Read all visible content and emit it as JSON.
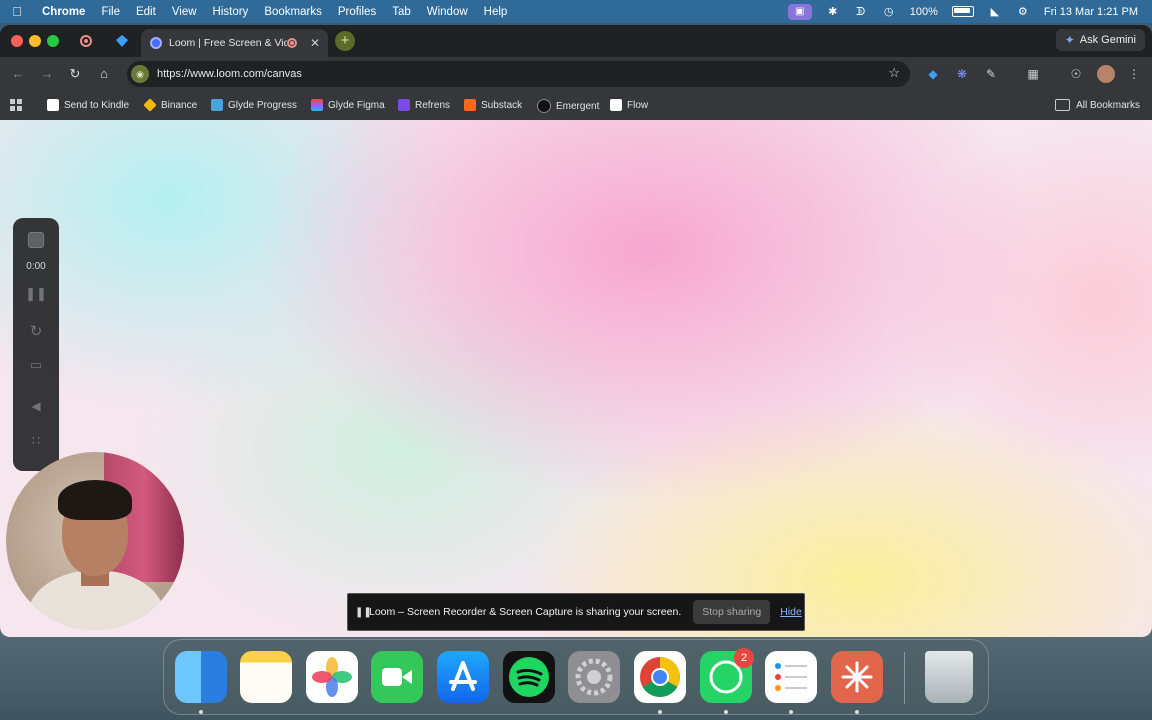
{
  "menubar": {
    "app_name": "Chrome",
    "items": [
      "File",
      "Edit",
      "View",
      "History",
      "Bookmarks",
      "Profiles",
      "Tab",
      "Window",
      "Help"
    ],
    "battery": "100%",
    "datetime": "Fri 13 Mar  1:21 PM"
  },
  "browser": {
    "tab_title": "Loom | Free Screen & Vide",
    "new_tab": "+",
    "close_tab": "✕",
    "ask_gemini": "Ask Gemini",
    "url": "https://www.loom.com/canvas",
    "bookmarks": [
      "Send to Kindle",
      "Binance",
      "Glyde Progress",
      "Glyde Figma",
      "Refrens",
      "Substack",
      "Emergent",
      "Flow"
    ],
    "all_bookmarks": "All Bookmarks"
  },
  "loom_controls": {
    "timer": "0:00"
  },
  "share_banner": {
    "message": "Loom – Screen Recorder & Screen Capture is sharing your screen.",
    "stop_label": "Stop sharing",
    "hide_label": "Hide"
  },
  "dock": {
    "apps": [
      "Finder",
      "Notes",
      "Photos",
      "FaceTime",
      "App Store",
      "Spotify",
      "System Settings",
      "Google Chrome",
      "WhatsApp",
      "Reminders",
      "Claude",
      "Trash"
    ],
    "whatsapp_badge": "2"
  },
  "colors": {
    "menubar": "#2f6a98",
    "tab_active": "#35373a",
    "window_bg": "#1f2123",
    "link": "#8ab4f8",
    "badge": "#e8473f"
  }
}
